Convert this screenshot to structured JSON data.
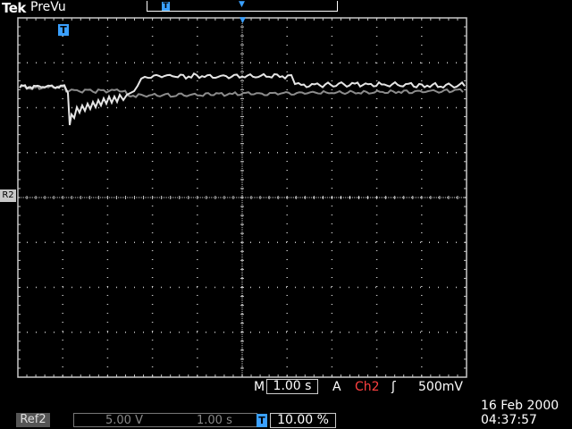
{
  "header": {
    "brand": "Tek",
    "mode": "PreVu",
    "record_marker": "T",
    "trigger_marker": "▼"
  },
  "screen": {
    "trigger_pos_marker": "T",
    "trigger_point": "▼",
    "ref_label": "R2"
  },
  "timebase": {
    "m_label": "M",
    "value": "1.00 s"
  },
  "trigger": {
    "a_label": "A",
    "source": "Ch2",
    "slope": "ʃ",
    "level": "500mV"
  },
  "reference": {
    "label": "Ref2",
    "volts": "5.00 V",
    "time": "1.00 s"
  },
  "position": {
    "marker": "T",
    "value": "10.00 %"
  },
  "clock": {
    "date": "16 Feb  2000",
    "time": "04:37:57"
  },
  "colors": {
    "trace_primary": "#e6e6e6",
    "trace_reference": "#8c8c8c",
    "grid": "#c8c8c8",
    "accent": "#3aa0ff",
    "channel": "#ff4040"
  }
}
